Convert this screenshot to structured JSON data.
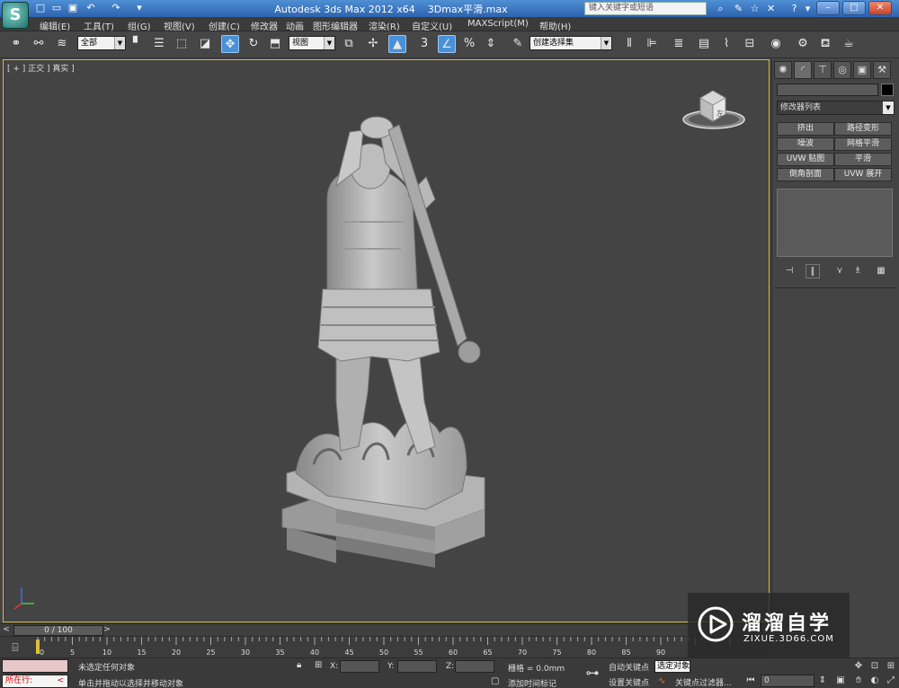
{
  "titlebar": {
    "app_title": "Autodesk 3ds Max  2012 x64",
    "file_name": "3Dmax平滑.max",
    "search_placeholder": "键入关键字或短语"
  },
  "menu": [
    "编辑(E)",
    "工具(T)",
    "组(G)",
    "视图(V)",
    "创建(C)",
    "修改器",
    "动画",
    "图形编辑器",
    "渲染(R)",
    "自定义(U)",
    "MAXScript(M)",
    "帮助(H)"
  ],
  "toolbar": {
    "selection_filter": "全部",
    "reference_coord": "视图",
    "named_selection_placeholder": "创建选择集",
    "snap_label": "3"
  },
  "viewport": {
    "label": "[ + ] 正交 ] 真实 ]",
    "viewcube_face": "左"
  },
  "command_panel": {
    "modifier_list": "修改器列表",
    "buttons": [
      "挤出",
      "路径变形",
      "噪波",
      "网格平滑",
      "UVW 贴图",
      "平滑",
      "倒角剖面",
      "UVW 展开"
    ]
  },
  "timeline": {
    "frame_display": "0 / 100",
    "ticks": [
      "0",
      "5",
      "10",
      "15",
      "20",
      "25",
      "30",
      "35",
      "40",
      "45",
      "50",
      "55",
      "60",
      "65",
      "70",
      "75",
      "80",
      "85",
      "90"
    ]
  },
  "status": {
    "running_label": "所在行:",
    "selection_status": "未选定任何对象",
    "prompt": "单击并拖动以选择并移动对象",
    "x_label": "X:",
    "y_label": "Y:",
    "z_label": "Z:",
    "grid": "栅格 = 0.0mm",
    "add_time_tag": "添加时间标记",
    "auto_key": "自动关键点",
    "set_key": "设置关键点",
    "selection_set": "选定对象",
    "key_filters": "关键点过滤器...",
    "current_frame": "0"
  },
  "watermark": {
    "title": "溜溜自学",
    "url": "ZIXUE.3D66.COM"
  },
  "colors": {
    "viewport_border": "#d6b93a",
    "accent": "#4a90d9",
    "titlebar": "#3a78c3"
  }
}
